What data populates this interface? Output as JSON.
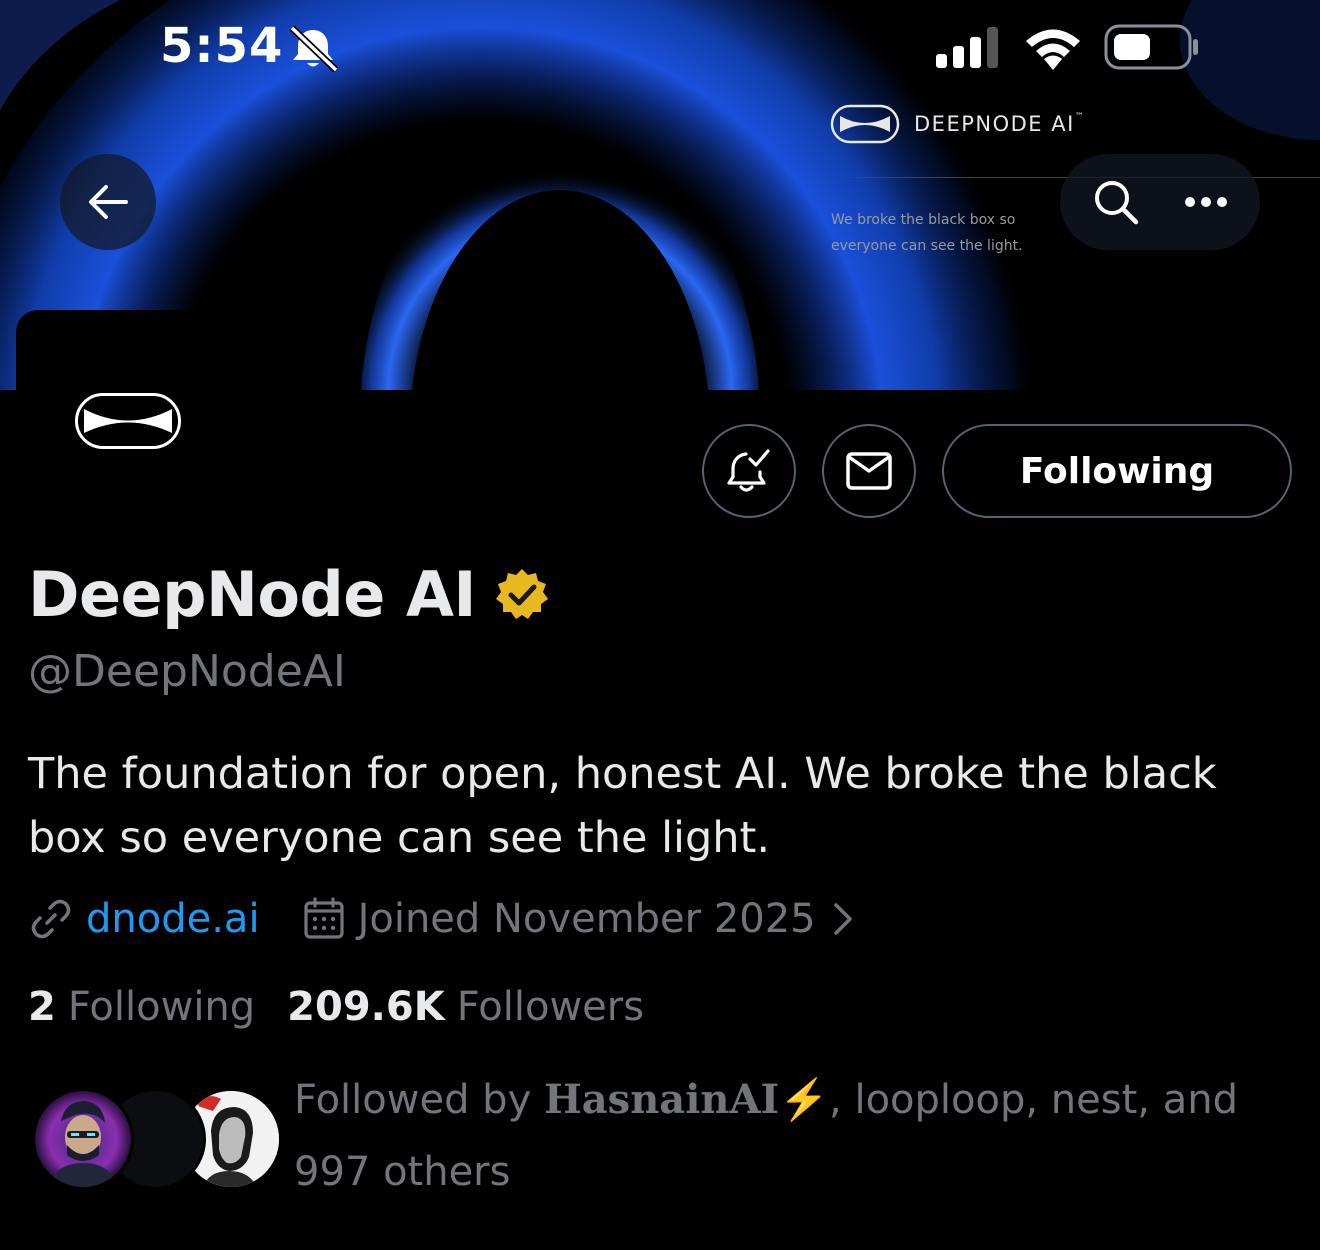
{
  "status_bar": {
    "time": "5:54",
    "icons": [
      "bell-slash-icon",
      "cellular-signal-icon",
      "wifi-icon",
      "battery-icon"
    ]
  },
  "banner": {
    "brand_name": "DEEPNODE AI",
    "brand_tm": "™",
    "tagline": "We broke the black box so everyone can see the light."
  },
  "nav": {
    "back_icon": "arrow-left-icon",
    "search_icon": "search-icon",
    "more_icon": "more-horizontal-icon"
  },
  "actions": {
    "notify_icon": "bell-check-icon",
    "message_icon": "envelope-icon",
    "following_label": "Following"
  },
  "profile": {
    "display_name": "DeepNode AI",
    "verified_badge": "gold-verified-badge-icon",
    "handle": "@DeepNodeAI",
    "bio": "The foundation for open, honest AI. We broke the black box so everyone can see the light.",
    "website": "dnode.ai",
    "joined": "Joined November 2025",
    "following_count": "2",
    "following_label": "Following",
    "followers_count": "209.6K",
    "followers_label": "Followers"
  },
  "followed_by": {
    "prefix": "Followed by ",
    "names_styled": "HasnainAI⚡",
    "rest": ", looploop, nest, and 997 others"
  },
  "colors": {
    "background": "#000000",
    "text_primary": "#e7e9ea",
    "text_secondary": "#71767b",
    "link": "#1d9bf0",
    "border": "#536471",
    "verified_gold": "#e8b821"
  }
}
